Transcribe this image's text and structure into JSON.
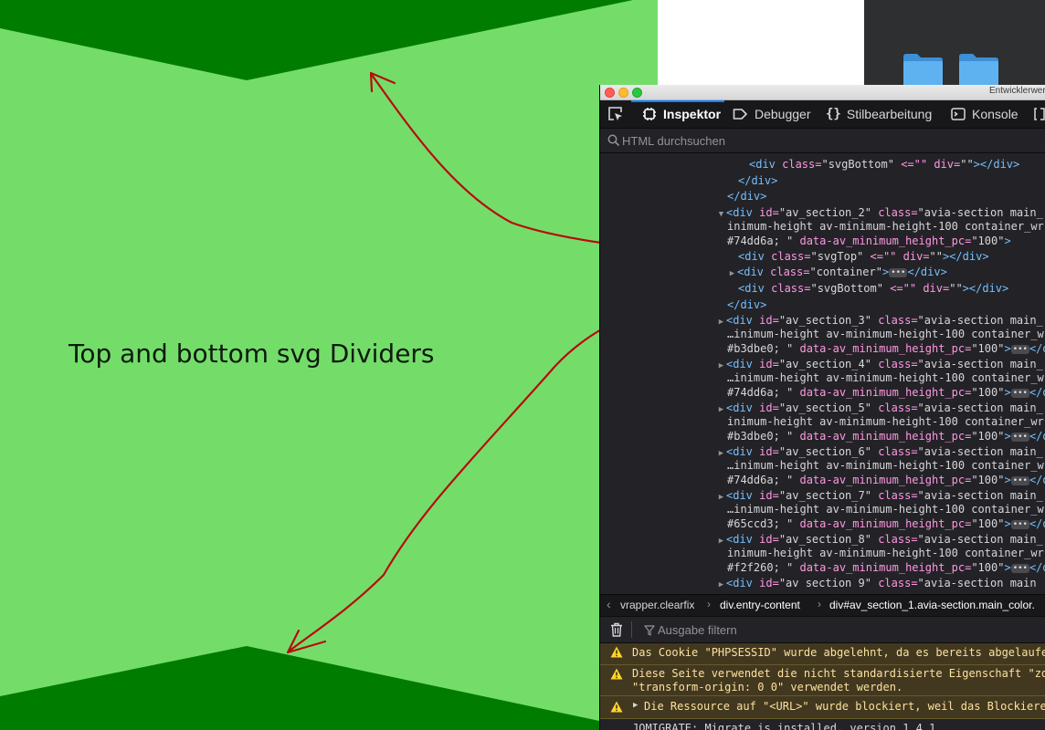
{
  "page": {
    "annotation": "Top and bottom svg Dividers",
    "colors": {
      "section_green": "#74dd6a",
      "divider_dark_green": "#007d00",
      "arrow_red": "#b80c0c"
    }
  },
  "devtools": {
    "window_title": "Entwicklerwerkzeuge",
    "tabs": [
      {
        "label": "Inspektor",
        "icon": "inspector-icon"
      },
      {
        "label": "Debugger",
        "icon": "debugger-icon"
      },
      {
        "label": "Stilbearbeitung",
        "icon": "style-editor-icon"
      },
      {
        "label": "Konsole",
        "icon": "console-icon"
      }
    ],
    "search_placeholder": "HTML durchsuchen",
    "breadcrumb": [
      "vrapper.clearfix",
      "div.entry-content",
      "div#av_section_1.avia-section.main_color."
    ],
    "filter_placeholder": "Ausgabe filtern",
    "console": {
      "warnings": [
        [
          "Das Cookie \"PHPSESSID\" wurde abgelehnt, da es bereits abgelaufen ist."
        ],
        [
          "Diese Seite verwendet die nicht standardisierte Eigenschaft \"zoom\".",
          "\"transform-origin: 0 0\" verwendet werden."
        ],
        [
          "Die Ressource auf \"<URL>\" wurde blockiert, weil das Blockieren"
        ]
      ],
      "log": "JQMIGRATE: Migrate is installed, version 1.4.1"
    }
  }
}
